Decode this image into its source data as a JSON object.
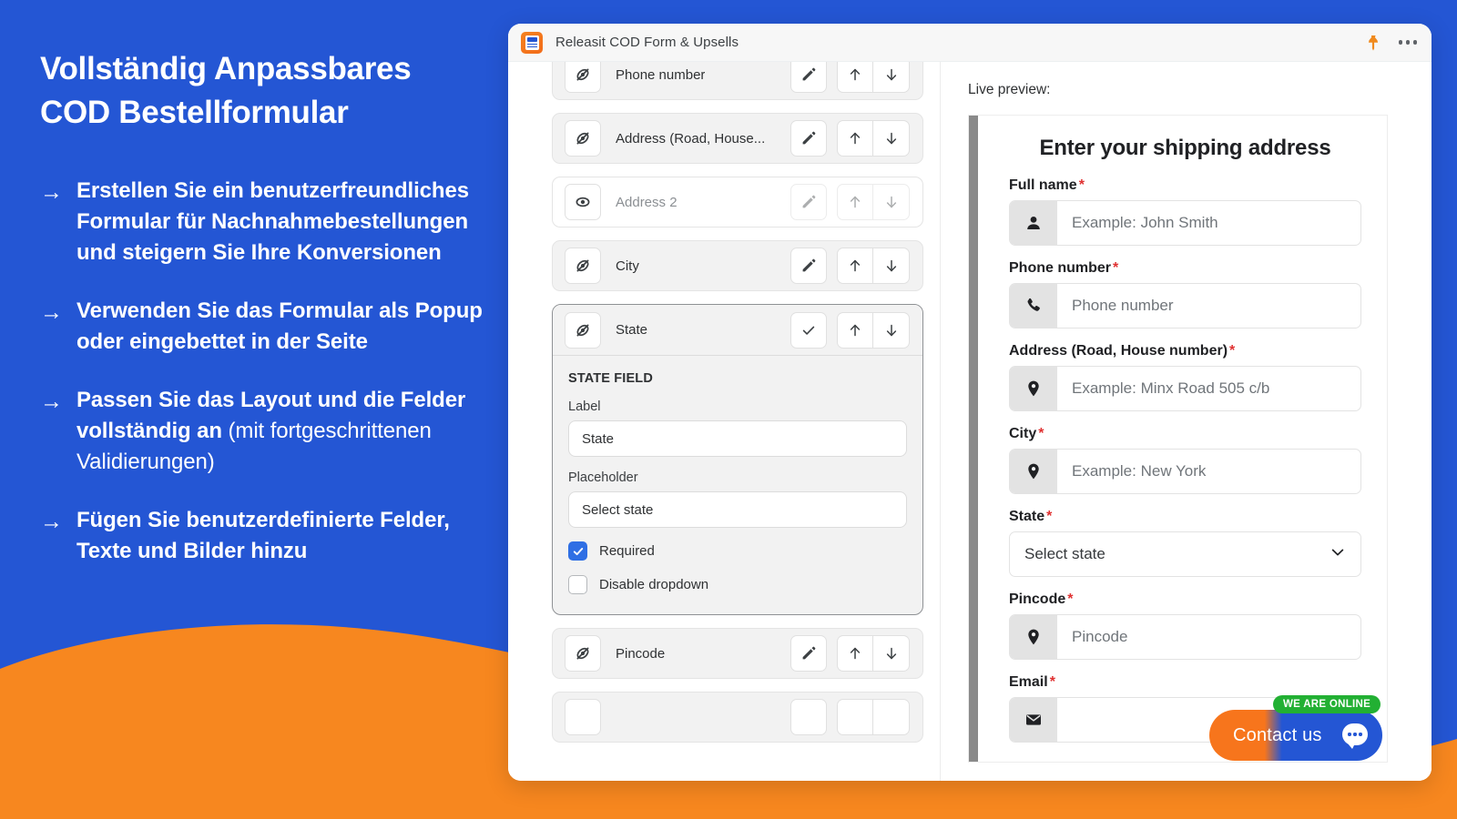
{
  "theme": {
    "blue": "#2456d4",
    "orange": "#f7871f",
    "accent_check": "#2f6fe4",
    "required_red": "#e03131",
    "online_green": "#22b033"
  },
  "left_panel": {
    "headline": "Vollständig Anpassbares\nCOD Bestellformular",
    "arrow_glyph": "→",
    "bullets": [
      {
        "bold": "Erstellen Sie ein benutzerfreundliches Formular für Nachnahmebestellungen und steigern Sie Ihre Konversionen",
        "light": ""
      },
      {
        "bold": "Verwenden Sie das Formular als Popup oder eingebettet in der Seite",
        "light": ""
      },
      {
        "bold": "Passen Sie das Layout und die Felder vollständig an",
        "light": " (mit fortgeschrittenen Validierungen)"
      },
      {
        "bold": "Fügen Sie benutzerdefinierte Felder, Texte und Bilder hinzu",
        "light": ""
      }
    ]
  },
  "app": {
    "title": "Releasit COD Form & Upsells",
    "icon_name": "releasit-app-icon",
    "pin_icon": "pin-icon",
    "more_icon": "more-options-icon"
  },
  "fields_panel": {
    "rows": [
      {
        "label": "Phone number",
        "visibility_icon": "eye-off-icon",
        "hidden_style": false,
        "muted": false,
        "edit_icon": "pencil-icon",
        "up_icon": "arrow-up-icon",
        "down_icon": "arrow-down-icon",
        "faded": false
      },
      {
        "label": "Address (Road, House...",
        "visibility_icon": "eye-off-icon",
        "hidden_style": false,
        "muted": false,
        "edit_icon": "pencil-icon",
        "up_icon": "arrow-up-icon",
        "down_icon": "arrow-down-icon",
        "faded": false
      },
      {
        "label": "Address 2",
        "visibility_icon": "eye-icon",
        "hidden_style": true,
        "muted": true,
        "edit_icon": "pencil-icon",
        "up_icon": "arrow-up-icon",
        "down_icon": "arrow-down-icon",
        "faded": true
      },
      {
        "label": "City",
        "visibility_icon": "eye-off-icon",
        "hidden_style": false,
        "muted": false,
        "edit_icon": "pencil-icon",
        "up_icon": "arrow-up-icon",
        "down_icon": "arrow-down-icon",
        "faded": false
      }
    ],
    "expanded": {
      "header_label": "State",
      "visibility_icon": "eye-off-icon",
      "confirm_icon": "check-icon",
      "up_icon": "arrow-up-icon",
      "down_icon": "arrow-down-icon",
      "section_title": "STATE FIELD",
      "label_caption": "Label",
      "label_value": "State",
      "placeholder_caption": "Placeholder",
      "placeholder_value": "Select state",
      "required_label": "Required",
      "required_checked": true,
      "disable_dropdown_label": "Disable dropdown",
      "disable_dropdown_checked": false
    },
    "rows_after": [
      {
        "label": "Pincode",
        "visibility_icon": "eye-off-icon",
        "hidden_style": false,
        "muted": false,
        "edit_icon": "pencil-icon",
        "up_icon": "arrow-up-icon",
        "down_icon": "arrow-down-icon",
        "faded": false
      }
    ]
  },
  "preview": {
    "title": "Live preview:",
    "heading": "Enter your shipping address",
    "required_mark": "*",
    "fields": [
      {
        "label": "Full name",
        "required": true,
        "icon": "person-icon",
        "placeholder": "Example: John Smith",
        "type": "text"
      },
      {
        "label": "Phone number",
        "required": true,
        "icon": "phone-icon",
        "placeholder": "Phone number",
        "type": "text"
      },
      {
        "label": "Address (Road, House number)",
        "required": true,
        "icon": "location-pin-icon",
        "placeholder": "Example: Minx Road 505 c/b",
        "type": "text"
      },
      {
        "label": "City",
        "required": true,
        "icon": "location-pin-icon",
        "placeholder": "Example: New York",
        "type": "text"
      },
      {
        "label": "State",
        "required": true,
        "icon": "chevron-down-icon",
        "placeholder": "Select state",
        "type": "select"
      },
      {
        "label": "Pincode",
        "required": true,
        "icon": "location-pin-icon",
        "placeholder": "Pincode",
        "type": "text"
      },
      {
        "label": "Email",
        "required": true,
        "icon": "mail-icon",
        "placeholder": "",
        "type": "text"
      }
    ]
  },
  "contact_widget": {
    "label": "Contact us",
    "badge": "WE ARE ONLINE",
    "bubble_icon": "chat-bubble-icon"
  }
}
